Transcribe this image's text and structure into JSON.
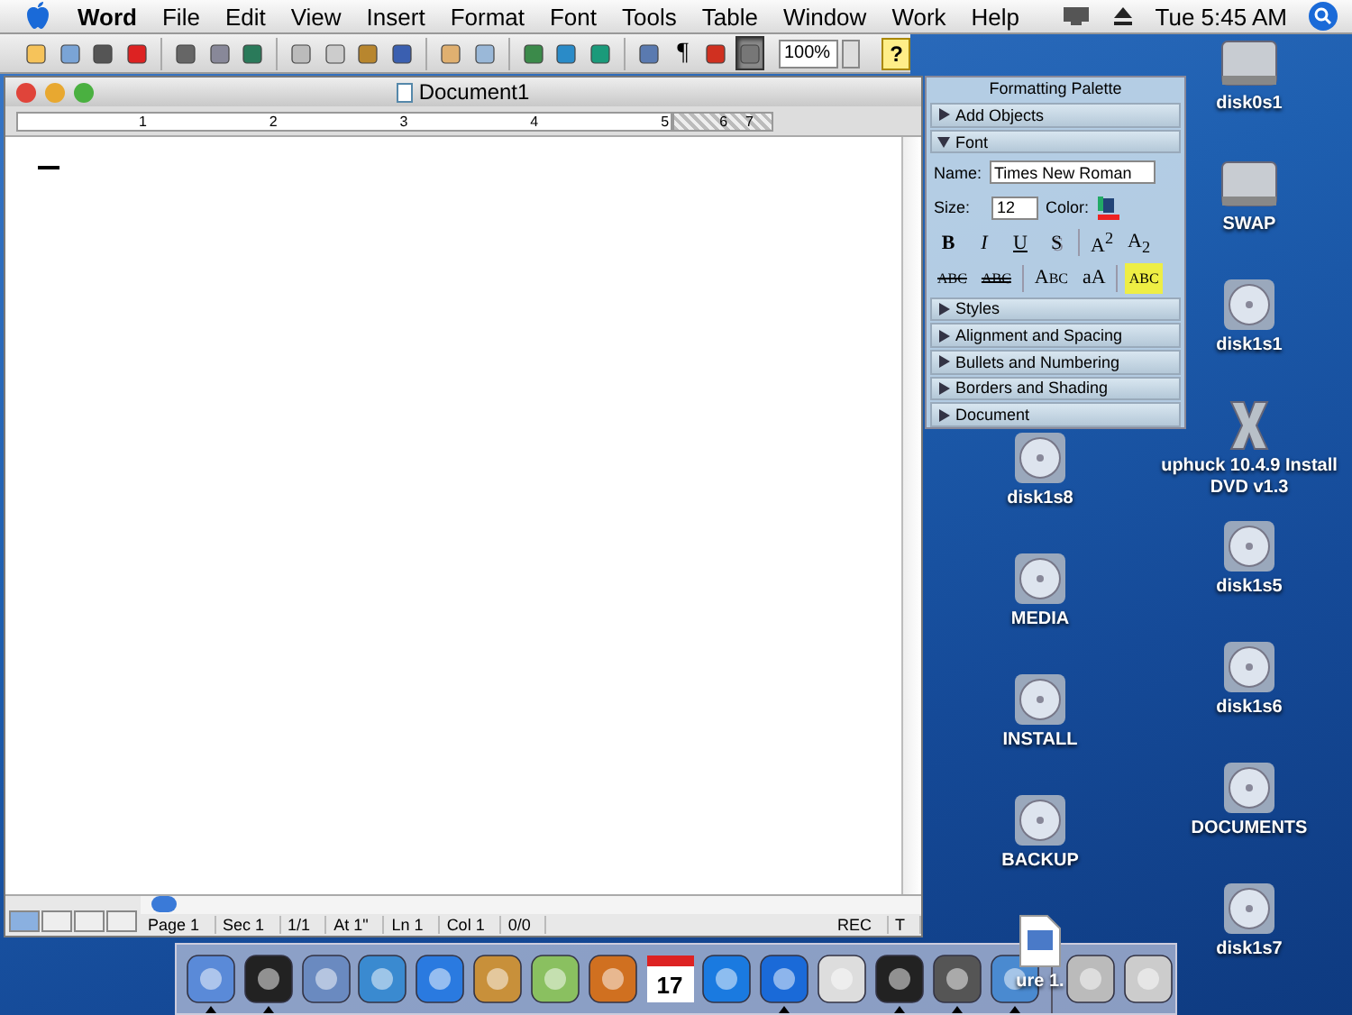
{
  "menubar": {
    "app": "Word",
    "menus": [
      "File",
      "Edit",
      "View",
      "Insert",
      "Format",
      "Font",
      "Tools",
      "Table",
      "Window",
      "Work",
      "Help"
    ],
    "clock": "Tue 5:45 AM"
  },
  "toolbar": {
    "items": [
      {
        "kind": "new",
        "pressed": false
      },
      {
        "kind": "open",
        "pressed": false
      },
      {
        "kind": "save",
        "pressed": false
      },
      {
        "kind": "flag",
        "pressed": false
      },
      {
        "kind": "sep"
      },
      {
        "kind": "print",
        "pressed": false
      },
      {
        "kind": "preview",
        "pressed": false
      },
      {
        "kind": "globe",
        "pressed": false
      },
      {
        "kind": "sep"
      },
      {
        "kind": "cut",
        "pressed": false
      },
      {
        "kind": "copy",
        "pressed": false
      },
      {
        "kind": "paste",
        "pressed": false
      },
      {
        "kind": "brush",
        "pressed": false
      },
      {
        "kind": "sep"
      },
      {
        "kind": "undo",
        "pressed": false
      },
      {
        "kind": "redo",
        "pressed": false
      },
      {
        "kind": "sep"
      },
      {
        "kind": "pencil",
        "pressed": false
      },
      {
        "kind": "table",
        "pressed": false
      },
      {
        "kind": "columns",
        "pressed": false
      },
      {
        "kind": "sep"
      },
      {
        "kind": "magnifier",
        "pressed": false
      },
      {
        "kind": "pilcrow",
        "label": "¶",
        "pressed": false
      },
      {
        "kind": "toolbox",
        "pressed": false
      },
      {
        "kind": "textbox",
        "pressed": true
      }
    ],
    "zoom": "100%",
    "help": "?"
  },
  "document": {
    "title": "Document1",
    "ruler": [
      "1",
      "2",
      "3",
      "4",
      "5",
      "6",
      "7"
    ],
    "views": [
      {
        "selected": true
      },
      {
        "selected": false
      },
      {
        "selected": false
      },
      {
        "selected": false
      }
    ],
    "status": [
      "Page 1",
      "Sec 1",
      "1/1",
      "At 1\"",
      "Ln 1",
      "Col 1",
      "0/0"
    ],
    "rec": "REC",
    "trk": "T"
  },
  "palette": {
    "title": "Formatting Palette",
    "top_sections": [
      {
        "label": "Add Objects",
        "expanded": false
      },
      {
        "label": "Font",
        "expanded": true
      }
    ],
    "name_label": "Name:",
    "font_name": "Times New Roman",
    "size_label": "Size:",
    "size": "12",
    "color_label": "Color:",
    "style_buttons": [
      {
        "kind": "bold",
        "label": "B"
      },
      {
        "kind": "italic",
        "label": "I"
      },
      {
        "kind": "underline",
        "label": "U"
      },
      {
        "kind": "shadow",
        "label": "S"
      },
      {
        "kind": "sep"
      },
      {
        "kind": "plain",
        "label": "A$^{2}$"
      },
      {
        "kind": "plain",
        "label": "A$_{2}$"
      }
    ],
    "effect_buttons": [
      {
        "kind": "strike",
        "label": "ABC"
      },
      {
        "kind": "dstrike",
        "label": "ABC"
      },
      {
        "kind": "sep"
      },
      {
        "kind": "smallcaps",
        "label": "Abc"
      },
      {
        "kind": "plain",
        "label": "aA"
      },
      {
        "kind": "sep"
      },
      {
        "kind": "highlight",
        "label": "ABC"
      }
    ],
    "sections": [
      {
        "label": "Styles",
        "expanded": false
      },
      {
        "label": "Alignment and Spacing",
        "expanded": false
      },
      {
        "label": "Bullets and Numbering",
        "expanded": false
      },
      {
        "label": "Borders and Shading",
        "expanded": false
      },
      {
        "label": "Document",
        "expanded": false
      }
    ]
  },
  "desktop": {
    "left_column": [
      {
        "kind": "disc",
        "label": "disk1s8"
      },
      {
        "kind": "disc",
        "label": "MEDIA"
      },
      {
        "kind": "disc",
        "label": "INSTALL"
      },
      {
        "kind": "disc",
        "label": "BACKUP"
      },
      {
        "kind": "file",
        "label": "ure 1."
      }
    ],
    "right_column": [
      {
        "kind": "drive",
        "label": "disk0s1"
      },
      {
        "kind": "drive",
        "label": "SWAP"
      },
      {
        "kind": "disc",
        "label": "disk1s1"
      },
      {
        "kind": "x",
        "label": "uphuck 10.4.9 Install DVD v1.3"
      },
      {
        "kind": "disc",
        "label": "disk1s5"
      },
      {
        "kind": "disc",
        "label": "disk1s6"
      },
      {
        "kind": "disc",
        "label": "DOCUMENTS"
      },
      {
        "kind": "disc",
        "label": "disk1s7"
      }
    ]
  },
  "dock": {
    "items": [
      {
        "kind": "face",
        "running": true
      },
      {
        "kind": "gauge",
        "running": true
      },
      {
        "kind": "stamp",
        "running": false
      },
      {
        "kind": "compass",
        "running": false
      },
      {
        "kind": "bubble",
        "running": false
      },
      {
        "kind": "book",
        "running": false
      },
      {
        "kind": "cd",
        "running": false
      },
      {
        "kind": "camera",
        "running": false
      },
      {
        "kind": "calendar",
        "label": "17",
        "running": false
      },
      {
        "kind": "ring",
        "running": false
      },
      {
        "kind": "w",
        "running": true
      },
      {
        "kind": "panel",
        "running": false
      },
      {
        "kind": "terminal",
        "running": true
      },
      {
        "kind": "device",
        "running": true
      },
      {
        "kind": "photos",
        "running": true
      },
      {
        "kind": "sep"
      },
      {
        "kind": "at",
        "running": false
      },
      {
        "kind": "trash",
        "running": false
      }
    ]
  }
}
